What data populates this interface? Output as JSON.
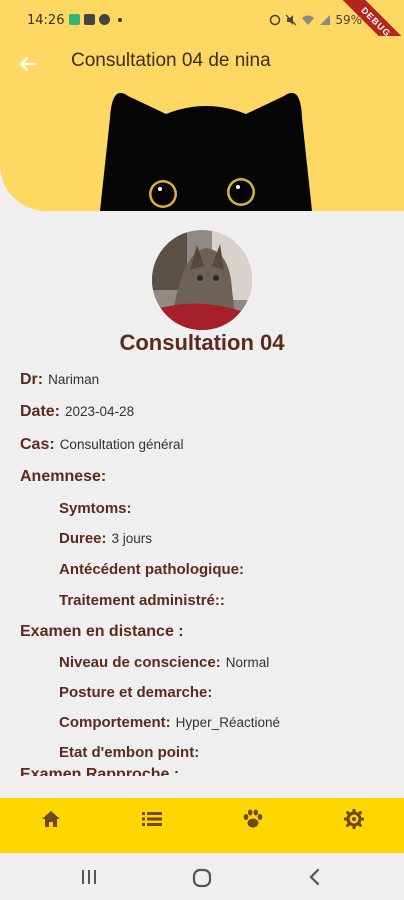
{
  "status_bar": {
    "time": "14:26",
    "battery": "59%",
    "debug_label": "DEBUG"
  },
  "header": {
    "title": "Consultation 04 de nina",
    "back_icon": "arrow-left-icon"
  },
  "consultation": {
    "title": "Consultation 04",
    "doctor_label": "Dr:",
    "doctor_value": "Nariman",
    "date_label": "Date:",
    "date_value": "2023-04-28",
    "case_label": "Cas:",
    "case_value": "Consultation général",
    "anamnese": {
      "label": "Anemnese:",
      "symptoms_label": "Symtoms:",
      "duration_label": "Duree:",
      "duration_value": "3 jours",
      "history_label": "Antécédent pathologique:",
      "treatment_label": "Traitement administré::"
    },
    "distance_exam": {
      "label": "Examen en distance :",
      "consciousness_label": "Niveau de conscience:",
      "consciousness_value": "Normal",
      "posture_label": "Posture et demarche:",
      "behaviour_label": "Comportement:",
      "behaviour_value": "Hyper_Réactioné",
      "body_condition_label": "Etat d'embon point:"
    },
    "close_exam_label": "Examen Rapproche :"
  },
  "bottom_nav": {
    "items": [
      "home-icon",
      "list-icon",
      "paw-icon",
      "gear-icon"
    ]
  },
  "colors": {
    "header_bg": "#fed863",
    "nav_bg": "#ffd600",
    "label": "#5b2b1f",
    "page_bg": "#efefef"
  }
}
